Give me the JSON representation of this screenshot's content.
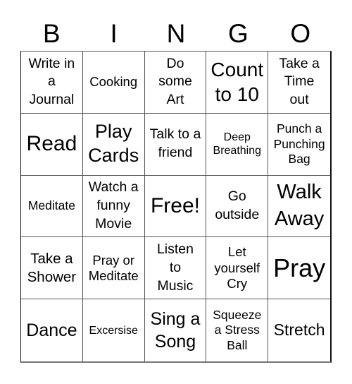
{
  "card": {
    "header_letters": [
      "B",
      "I",
      "N",
      "G",
      "O"
    ],
    "cells": [
      [
        "Write in a Journal",
        "Cooking",
        "Do some Art",
        "Count to 10",
        "Take a Time out"
      ],
      [
        "Read",
        "Play Cards",
        "Talk to a friend",
        "Deep Breathing",
        "Punch a Punching Bag"
      ],
      [
        "Meditate",
        "Watch a funny Movie",
        "Free!",
        "Go outside",
        "Walk Away"
      ],
      [
        "Take a Shower",
        "Pray or Meditate",
        "Listen to Music",
        "Let yourself Cry",
        "Pray"
      ],
      [
        "Dance",
        "Excersise",
        "Sing a Song",
        "Squeeze a Stress Ball",
        "Stretch"
      ]
    ],
    "free_space": "Free!"
  }
}
